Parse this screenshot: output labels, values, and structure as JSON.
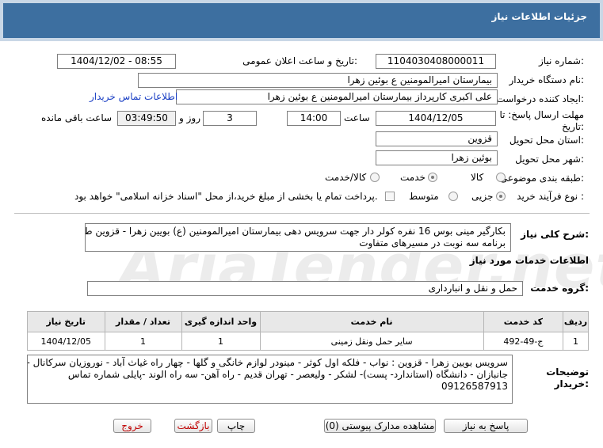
{
  "header": {
    "title": "جزئیات اطلاعات نیاز"
  },
  "watermark": {
    "text": "AriaTender.net"
  },
  "fields": {
    "need_number_label": "شماره نیاز:",
    "need_number": "1104030408000011",
    "announce_label": "تاریخ و ساعت اعلان عمومی:",
    "announce_value": "1404/12/02 - 08:55",
    "buyer_org_label": "نام دستگاه خریدار:",
    "buyer_org": "بیمارستان امیرالمومنین ع  بوئین زهرا",
    "requester_label": "ایجاد کننده درخواست:",
    "requester": "علی اکبری کارپرداز بیمارستان امیرالمومنین ع  بوئین زهرا",
    "contact_link": "اطلاعات تماس خریدار",
    "deadline_label_1": "مهلت ارسال پاسخ: تا",
    "deadline_label_2": "تاریخ:",
    "deadline_date": "1404/12/05",
    "time_label": "ساعت",
    "deadline_time": "14:00",
    "days_value": "3",
    "days_and_label": "روز و",
    "remaining_time": "03:49:50",
    "remaining_label": "ساعت باقی مانده",
    "province_label": "استان محل تحویل:",
    "province": "قزوین",
    "city_label": "شهر محل تحویل:",
    "city": "بوئین زهرا"
  },
  "category": {
    "label": "طبقه بندی موضوعی:",
    "options": [
      "کالا",
      "خدمت",
      "کالا/خدمت"
    ],
    "selected": "خدمت"
  },
  "purchase_type": {
    "label": "نوع فرآیند خرید :",
    "options": [
      "جزیی",
      "متوسط"
    ],
    "selected": "جزیی",
    "treasury_note": "پرداخت تمام یا بخشی از مبلغ خرید،از محل \"اسناد خزانه اسلامی\" خواهد بود."
  },
  "description": {
    "label": "شرح کلی نیاز:",
    "text_line1": "بکارگیر مینی بوس 16 نفره کولر دار جهت سرویس دهی  بیمارستان امیرالمومنین (ع) بویین زهرا - قزوین طبق",
    "text_line2": "برنامه سه نوبت در مسیرهای متفاوت"
  },
  "services": {
    "section_title": "اطلاعات خدمات مورد نیاز",
    "group_label": "گروه خدمت:",
    "group_value": "حمل و نقل و انبارداری",
    "columns": [
      "ردیف",
      "کد خدمت",
      "نام خدمت",
      "واحد اندازه گیری",
      "تعداد / مقدار",
      "تاریخ نیاز"
    ],
    "rows": [
      [
        "1",
        "ج-49-492",
        "سایر حمل ونقل زمینی",
        "1",
        "1",
        "1404/12/05"
      ]
    ]
  },
  "buyer_notes": {
    "label_1": "توضیحات",
    "label_2": "خریدار:",
    "line1": "سرویس بویین زهرا - قزوین : نواب - فلکه اول کوثر - مینودر لوازم خانگی و گلها - چهار راه غیاث آباد - نوروزیان سرکانال - میدان",
    "line2": "جانبازان - دانشگاه (استاندارد- پست)- لشکر - ولیعصر - تهران قدیم - راه آهن- سه راه الوند -پایلی شماره تماس",
    "line3": "09126587913"
  },
  "buttons": {
    "reply": "پاسخ به نیاز",
    "view_docs": "مشاهده مدارک پیوستی (0)",
    "print": "چاپ",
    "back": "بازگشت",
    "exit": "خروج"
  },
  "colors": {
    "header_bg": "#3d6fa0",
    "link": "#1a3fc4",
    "danger_text": "#c00000"
  }
}
